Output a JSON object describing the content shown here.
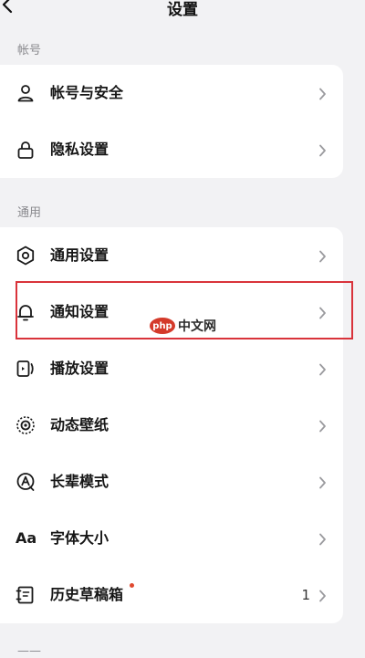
{
  "header": {
    "title": "设置"
  },
  "sections": [
    {
      "label": "帐号",
      "items": [
        {
          "label": "帐号与安全",
          "icon": "user-icon"
        },
        {
          "label": "隐私设置",
          "icon": "lock-icon"
        }
      ]
    },
    {
      "label": "通用",
      "items": [
        {
          "label": "通用设置",
          "icon": "gear-icon"
        },
        {
          "label": "通知设置",
          "icon": "bell-icon"
        },
        {
          "label": "播放设置",
          "icon": "play-settings-icon"
        },
        {
          "label": "动态壁纸",
          "icon": "wallpaper-icon"
        },
        {
          "label": "长辈模式",
          "icon": "elder-mode-icon"
        },
        {
          "label": "字体大小",
          "icon": "font-size-icon",
          "icon_text": "Aa"
        },
        {
          "label": "历史草稿箱",
          "icon": "drafts-icon",
          "count": "1",
          "has_dot": true
        }
      ]
    }
  ],
  "watermark": {
    "logo_text": "php",
    "text": "中文网"
  },
  "colors": {
    "highlight": "#d9333b",
    "dot": "#e0492f",
    "background": "#f2f2f4"
  }
}
